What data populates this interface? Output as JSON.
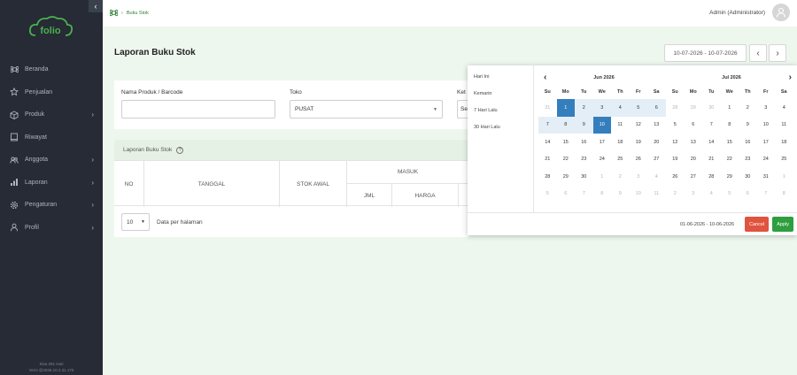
{
  "sidebar": {
    "logo_text": "folio",
    "collapse_glyph": "‹",
    "items": [
      {
        "label": "Beranda",
        "icon": "command-icon",
        "has_children": false
      },
      {
        "label": "Penjualan",
        "icon": "star-icon",
        "has_children": false
      },
      {
        "label": "Produk",
        "icon": "box-icon",
        "has_children": true
      },
      {
        "label": "Riwayat",
        "icon": "book-icon",
        "has_children": false
      },
      {
        "label": "Anggota",
        "icon": "users-icon",
        "has_children": true
      },
      {
        "label": "Laporan",
        "icon": "bar-chart-icon",
        "has_children": true
      },
      {
        "label": "Pengaturan",
        "icon": "gear-icon",
        "has_children": true
      },
      {
        "label": "Profil",
        "icon": "user-icon",
        "has_children": true
      }
    ],
    "footer_line1": "Sisa 291 Hari",
    "footer_line2": "Versi @2026.10.2.31.170"
  },
  "topbar": {
    "breadcrumb_icon": "command-icon",
    "breadcrumb_sep": "›",
    "breadcrumb": "Buku Stok",
    "user_name": "Admin (Administrator)"
  },
  "page": {
    "title": "Laporan Buku Stok",
    "date_range": "10-07-2026 - 10-07-2026",
    "prev_glyph": "‹",
    "next_glyph": "›"
  },
  "filters": {
    "product_label": "Nama Produk / Barcode",
    "product_value": "",
    "store_label": "Toko",
    "store_value": "PUSAT",
    "third_label": "Ket",
    "third_value": "Se"
  },
  "table": {
    "title": "Laporan Buku Stok",
    "info_glyph": "?",
    "headers": {
      "no": "NO",
      "tanggal": "TANGGAL",
      "stok_awal": "STOK AWAL",
      "masuk": "MASUK",
      "jml": "JML",
      "harga": "HARGA"
    },
    "per_page": "10",
    "per_page_label": "Data per halaman"
  },
  "datepicker": {
    "ranges": [
      "Hari Ini",
      "Kemarin",
      "7 Hari Lalu",
      "30 Hari Lalu"
    ],
    "prev_glyph": "‹",
    "next_glyph": "›",
    "dow": [
      "Su",
      "Mo",
      "Tu",
      "We",
      "Th",
      "Fr",
      "Sa"
    ],
    "left": {
      "title": "Jun 2026",
      "weeks": [
        [
          "31",
          "1",
          "2",
          "3",
          "4",
          "5",
          "6"
        ],
        [
          "7",
          "8",
          "9",
          "10",
          "11",
          "12",
          "13"
        ],
        [
          "14",
          "15",
          "16",
          "17",
          "18",
          "19",
          "20"
        ],
        [
          "21",
          "22",
          "23",
          "24",
          "25",
          "26",
          "27"
        ],
        [
          "28",
          "29",
          "30",
          "1",
          "2",
          "3",
          "4"
        ],
        [
          "5",
          "6",
          "7",
          "8",
          "9",
          "10",
          "11"
        ]
      ],
      "muted_cells": [
        [
          0,
          0
        ],
        [
          4,
          3
        ],
        [
          4,
          4
        ],
        [
          4,
          5
        ],
        [
          4,
          6
        ],
        [
          5,
          0
        ],
        [
          5,
          1
        ],
        [
          5,
          2
        ],
        [
          5,
          3
        ],
        [
          5,
          4
        ],
        [
          5,
          5
        ],
        [
          5,
          6
        ]
      ],
      "selected_cells": [
        [
          0,
          1
        ],
        [
          1,
          3
        ]
      ],
      "in_range_cells": [
        [
          0,
          2
        ],
        [
          0,
          3
        ],
        [
          0,
          4
        ],
        [
          0,
          5
        ],
        [
          0,
          6
        ],
        [
          1,
          0
        ],
        [
          1,
          1
        ],
        [
          1,
          2
        ]
      ]
    },
    "right": {
      "title": "Jul 2026",
      "weeks": [
        [
          "28",
          "29",
          "30",
          "1",
          "2",
          "3",
          "4"
        ],
        [
          "5",
          "6",
          "7",
          "8",
          "9",
          "10",
          "11"
        ],
        [
          "12",
          "13",
          "14",
          "15",
          "16",
          "17",
          "18"
        ],
        [
          "19",
          "20",
          "21",
          "22",
          "23",
          "24",
          "25"
        ],
        [
          "26",
          "27",
          "28",
          "29",
          "30",
          "31",
          "1"
        ],
        [
          "2",
          "3",
          "4",
          "5",
          "6",
          "7",
          "8"
        ]
      ],
      "muted_cells": [
        [
          0,
          0
        ],
        [
          0,
          1
        ],
        [
          0,
          2
        ],
        [
          4,
          6
        ],
        [
          5,
          0
        ],
        [
          5,
          1
        ],
        [
          5,
          2
        ],
        [
          5,
          3
        ],
        [
          5,
          4
        ],
        [
          5,
          5
        ],
        [
          5,
          6
        ]
      ],
      "selected_cells": [],
      "in_range_cells": []
    },
    "selected_range": "01-06-2026 - 10-06-2026",
    "cancel_label": "Cancel",
    "apply_label": "Apply"
  },
  "colors": {
    "sidebar_bg": "#262b35",
    "accent_green": "#2e7d32",
    "selected_blue": "#357ebd",
    "range_blue": "#e4eef6",
    "cancel_red": "#e0533e",
    "apply_green": "#2e9e3f"
  }
}
